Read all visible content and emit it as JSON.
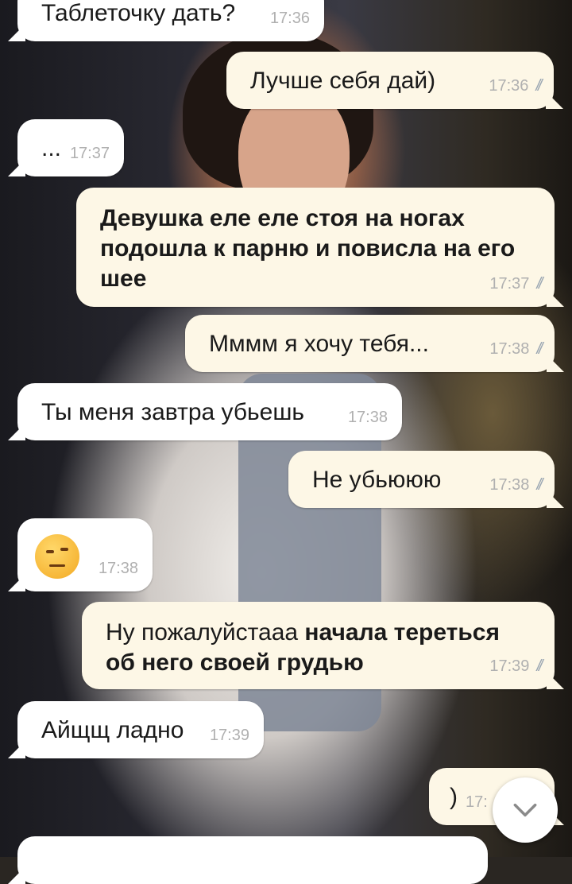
{
  "messages": [
    {
      "dir": "in",
      "text": "Таблеточку дать?",
      "time": "17:36"
    },
    {
      "dir": "out",
      "text": "Лучше себя дай)",
      "time": "17:36"
    },
    {
      "dir": "in",
      "text": "...",
      "time": "17:37"
    },
    {
      "dir": "out",
      "text": "Девушка еле еле стоя на ногах подошла к парню и повисла на его шее",
      "time": "17:37"
    },
    {
      "dir": "out",
      "text": "Мммм я хочу тебя...",
      "time": "17:38"
    },
    {
      "dir": "in",
      "text": "Ты меня завтра убьешь",
      "time": "17:38"
    },
    {
      "dir": "out",
      "text": "Не убьююю",
      "time": "17:38"
    },
    {
      "dir": "in",
      "emoji": "face-with-raised-eyebrow",
      "time": "17:38"
    },
    {
      "dir": "out",
      "text": "Ну пожалуйстааа",
      "text_bold": "начала тереться об него своей грудью",
      "time": "17:39"
    },
    {
      "dir": "in",
      "text": "Айщщ ладно",
      "time": "17:39"
    },
    {
      "dir": "out",
      "text": ")",
      "time": "17:"
    }
  ],
  "read_ticks": "//",
  "icons": {
    "scroll_down": "chevron-down-icon",
    "read_receipt": "double-check-icon"
  },
  "colors": {
    "incoming_bubble": "#ffffff",
    "outgoing_bubble": "#fdf7e6",
    "time_text": "#b0b0b0",
    "ticks": "#9aa6b2"
  }
}
